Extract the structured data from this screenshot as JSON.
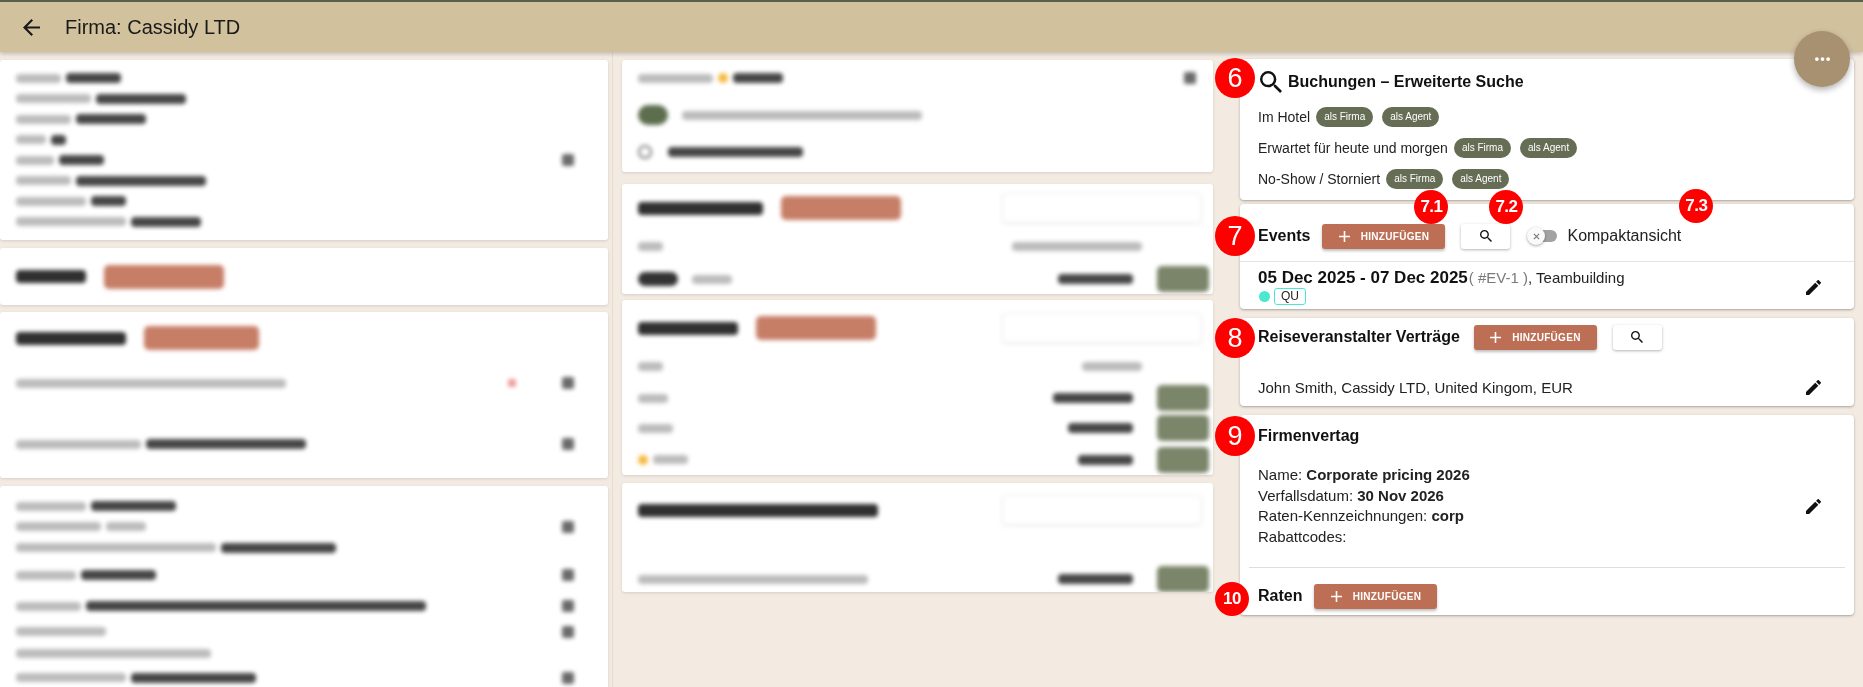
{
  "header": {
    "title": "Firma: Cassidy LTD"
  },
  "booking_search": {
    "callout": "6",
    "title": "Buchungen – Erweiterte Suche",
    "rows": [
      {
        "label": "Im Hotel",
        "chips": [
          "als Firma",
          "als Agent"
        ]
      },
      {
        "label": "Erwartet für heute und morgen",
        "chips": [
          "als Firma",
          "als Agent"
        ]
      },
      {
        "label": "No-Show / Storniert",
        "chips": [
          "als Firma",
          "als Agent"
        ]
      }
    ]
  },
  "events": {
    "callout": "7",
    "title": "Events",
    "add_button": {
      "label": "HINZUFÜGEN",
      "callout": "7.1"
    },
    "search_button": {
      "callout": "7.2"
    },
    "compact_view": {
      "label": "Kompaktansicht",
      "on": false,
      "callout": "7.3"
    },
    "items": [
      {
        "dates": "05 Dec 2025 - 07 Dec 2025",
        "code": "( #EV-1 )",
        "name": ", Teambuilding",
        "color": "#4be8d1",
        "tag": "QU"
      }
    ]
  },
  "tour_operator_contracts": {
    "callout": "8",
    "title": "Reiseveranstalter Verträge",
    "add_button": {
      "label": "HINZUFÜGEN"
    },
    "items": [
      "John Smith, Cassidy LTD, United Kingom, EUR"
    ]
  },
  "company_contract": {
    "callout": "9",
    "title": "Firmenvertag",
    "fields": [
      "Name: **Corporate pricing 2026**",
      "Verfallsdatum: **30 Nov 2026**",
      "Raten-Kennzeichnungen: **corp**",
      "Rabattcodes:"
    ],
    "rates": {
      "callout": "10",
      "title": "Raten",
      "add_button": {
        "label": "HINZUFÜGEN"
      }
    }
  }
}
